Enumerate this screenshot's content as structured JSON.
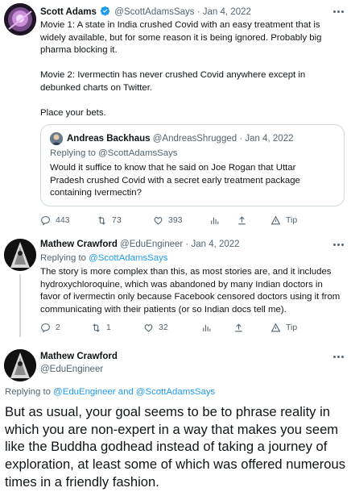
{
  "tweets": [
    {
      "name": "Scott Adams",
      "handle": "@ScottAdamsSays",
      "sep": "·",
      "date": "Jan 4, 2022",
      "verified": true,
      "text": "Movie 1: A state in India crushed Covid with an easy treatment that is widely available, but for some reason it is being ignored. Probably big pharma blocking it.\n\nMovie 2: Ivermectin has never crushed Covid anywhere except in debunked charts on Twitter.\n\nPlace your bets.",
      "actions": {
        "reply": "443",
        "retweet": "73",
        "like": "393",
        "analytics": "",
        "share": "",
        "tip": "Tip"
      }
    },
    {
      "name": "Mathew Crawford",
      "handle": "@EduEngineer",
      "sep": "·",
      "date": "Jan 4, 2022",
      "replying_prefix": "Replying to",
      "replying_to": "@ScottAdamsSays",
      "text": "The story is more complex than this, as most stories are, and it includes hydroxychloroquine, which was abandoned by many Indian doctors in favor of ivermectin only because Facebook censored doctors using it from communicating with their patients (or so Indian docs tell me).",
      "actions": {
        "reply": "2",
        "retweet": "1",
        "like": "32",
        "analytics": "",
        "share": "",
        "tip": "Tip"
      }
    }
  ],
  "quote": {
    "name": "Andreas Backhaus",
    "handle": "@AndreasShrugged",
    "sep": "·",
    "date": "Jan 4, 2022",
    "replying_prefix": "Replying to",
    "replying_to": "@ScottAdamsSays",
    "text": "Would it suffice to know that he said on Joe Rogan that Uttar Pradesh crushed Covid with a secret early treatment package containing Ivermectin?"
  },
  "main": {
    "name": "Mathew Crawford",
    "handle": "@EduEngineer",
    "replying_prefix": "Replying to",
    "replying_to": "@EduEngineer and @ScottAdamsSays",
    "text": "But as usual, your goal seems to be to phrase reality in which you are non-expert in a way that makes you seem like the Buddha godhead instead of taking a journey of exploration, at least some of which was offered numerous times in a friendly fashion."
  },
  "icons": {
    "reply": "reply-icon",
    "retweet": "retweet-icon",
    "like": "like-icon",
    "analytics": "analytics-icon",
    "share": "share-icon",
    "tip": "tip-icon",
    "more": "more-icon",
    "verified": "verified-badge-icon"
  },
  "colors": {
    "text": "#0f1419",
    "secondary": "#536471",
    "link": "#1d9bf0",
    "border": "#cfd9de"
  }
}
